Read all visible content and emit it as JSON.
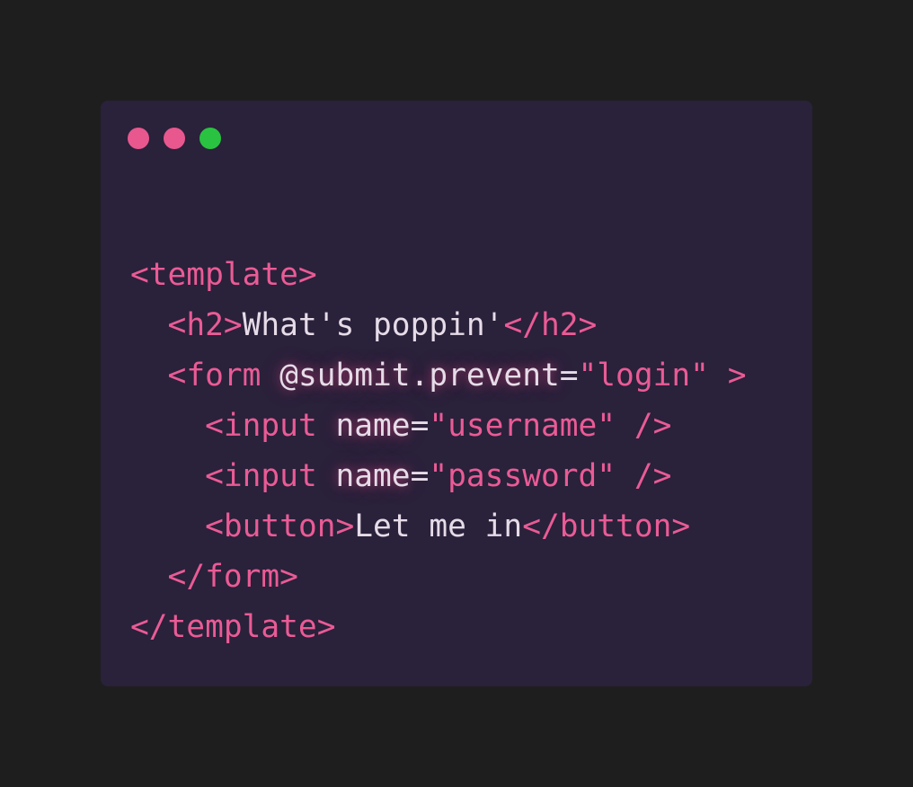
{
  "window": {
    "controls": [
      {
        "name": "close",
        "color": "#e8578e"
      },
      {
        "name": "minimize",
        "color": "#e8578e"
      },
      {
        "name": "maximize",
        "color": "#29c341"
      }
    ]
  },
  "code": {
    "line1": {
      "open": "<template>"
    },
    "line2": {
      "indent": "  ",
      "open": "<h2>",
      "text": "What's poppin'",
      "close": "</h2>"
    },
    "line3": {
      "indent": "  ",
      "open": "<form ",
      "attr": "@submit.prevent",
      "eq": "=",
      "value": "\"login\"",
      "close": " >"
    },
    "line4": {
      "indent": "    ",
      "open": "<input ",
      "attr": "name",
      "eq": "=",
      "value": "\"username\"",
      "close": " />"
    },
    "line5": {
      "indent": "    ",
      "open": "<input ",
      "attr": "name",
      "eq": "=",
      "value": "\"password\"",
      "close": " />"
    },
    "line6": {
      "indent": "    ",
      "open": "<button>",
      "text": "Let me in",
      "close": "</button>"
    },
    "line7": {
      "indent": "  ",
      "close": "</form>"
    },
    "line8": {
      "close": "</template>"
    }
  }
}
